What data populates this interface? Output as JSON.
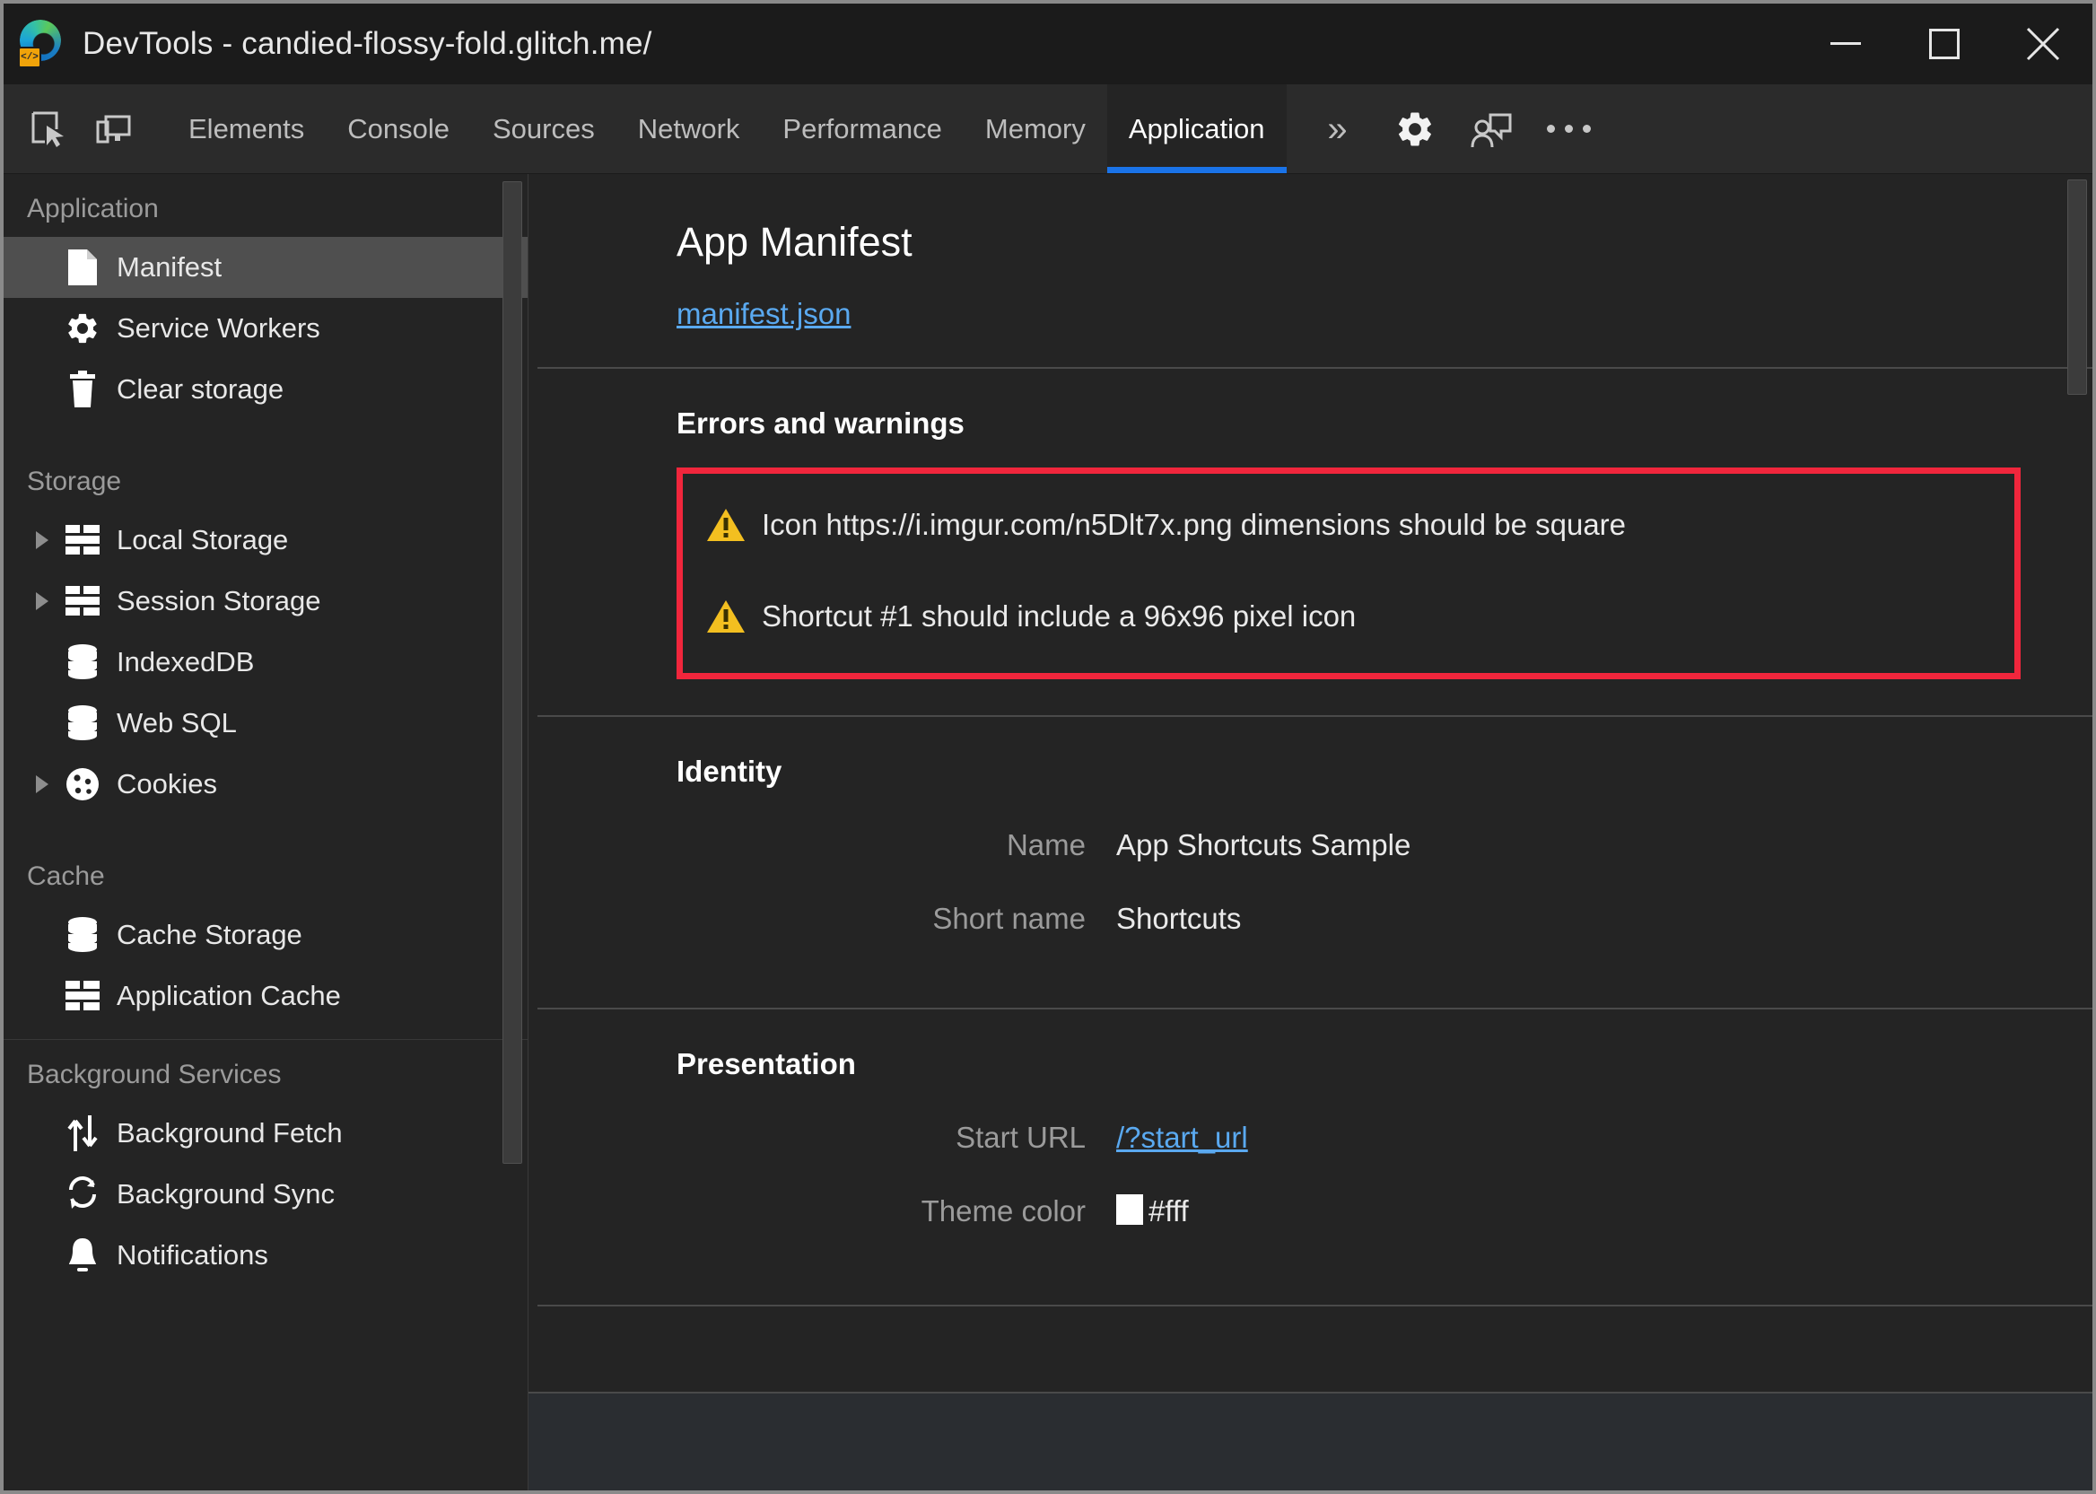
{
  "window": {
    "title": "DevTools - candied-flossy-fold.glitch.me/",
    "app_icon": "edge-devtools-icon",
    "badge_text": "</>",
    "controls": {
      "minimize": "minimize-button",
      "maximize": "maximize-button",
      "close": "close-button"
    }
  },
  "tabstrip": {
    "inspect_icon": "inspect-element-icon",
    "device_icon": "device-toolbar-icon",
    "tabs": [
      {
        "label": "Elements",
        "active": false
      },
      {
        "label": "Console",
        "active": false
      },
      {
        "label": "Sources",
        "active": false
      },
      {
        "label": "Network",
        "active": false
      },
      {
        "label": "Performance",
        "active": false
      },
      {
        "label": "Memory",
        "active": false
      },
      {
        "label": "Application",
        "active": true
      }
    ],
    "more_tabs": "»",
    "settings_icon": "gear-icon",
    "feedback_icon": "feedback-person-icon",
    "more_options": "more-options-icon",
    "active_underline_color": "#1a73e8"
  },
  "sidebar": {
    "sections": [
      {
        "title": "Application",
        "items": [
          {
            "label": "Manifest",
            "icon": "document-icon",
            "twisty": false,
            "selected": true
          },
          {
            "label": "Service Workers",
            "icon": "gear-icon",
            "twisty": false,
            "selected": false
          },
          {
            "label": "Clear storage",
            "icon": "trash-icon",
            "twisty": false,
            "selected": false
          }
        ]
      },
      {
        "title": "Storage",
        "items": [
          {
            "label": "Local Storage",
            "icon": "table-icon",
            "twisty": true,
            "selected": false
          },
          {
            "label": "Session Storage",
            "icon": "table-icon",
            "twisty": true,
            "selected": false
          },
          {
            "label": "IndexedDB",
            "icon": "database-icon",
            "twisty": false,
            "selected": false
          },
          {
            "label": "Web SQL",
            "icon": "database-icon",
            "twisty": false,
            "selected": false
          },
          {
            "label": "Cookies",
            "icon": "cookie-icon",
            "twisty": true,
            "selected": false
          }
        ]
      },
      {
        "title": "Cache",
        "items": [
          {
            "label": "Cache Storage",
            "icon": "database-icon",
            "twisty": false,
            "selected": false
          },
          {
            "label": "Application Cache",
            "icon": "table-icon",
            "twisty": false,
            "selected": false
          }
        ]
      },
      {
        "title": "Background Services",
        "items": [
          {
            "label": "Background Fetch",
            "icon": "up-down-arrows-icon",
            "twisty": false,
            "selected": false
          },
          {
            "label": "Background Sync",
            "icon": "sync-icon",
            "twisty": false,
            "selected": false
          },
          {
            "label": "Notifications",
            "icon": "bell-icon",
            "twisty": false,
            "selected": false
          }
        ]
      }
    ]
  },
  "main": {
    "title": "App Manifest",
    "manifest_link": "manifest.json",
    "errors_section": {
      "heading": "Errors and warnings",
      "highlight_color": "#f0263c",
      "items": [
        {
          "icon": "warning-icon",
          "text": "Icon https://i.imgur.com/n5Dlt7x.png dimensions should be square"
        },
        {
          "icon": "warning-icon",
          "text": "Shortcut #1 should include a 96x96 pixel icon"
        }
      ]
    },
    "identity_section": {
      "heading": "Identity",
      "rows": [
        {
          "key": "Name",
          "value": "App Shortcuts Sample",
          "is_link": false
        },
        {
          "key": "Short name",
          "value": "Shortcuts",
          "is_link": false
        }
      ]
    },
    "presentation_section": {
      "heading": "Presentation",
      "rows": [
        {
          "key": "Start URL",
          "value": "/?start_url",
          "is_link": true
        },
        {
          "key": "Theme color",
          "value": "#fff",
          "is_link": false,
          "swatch": "#ffffff"
        }
      ]
    }
  }
}
